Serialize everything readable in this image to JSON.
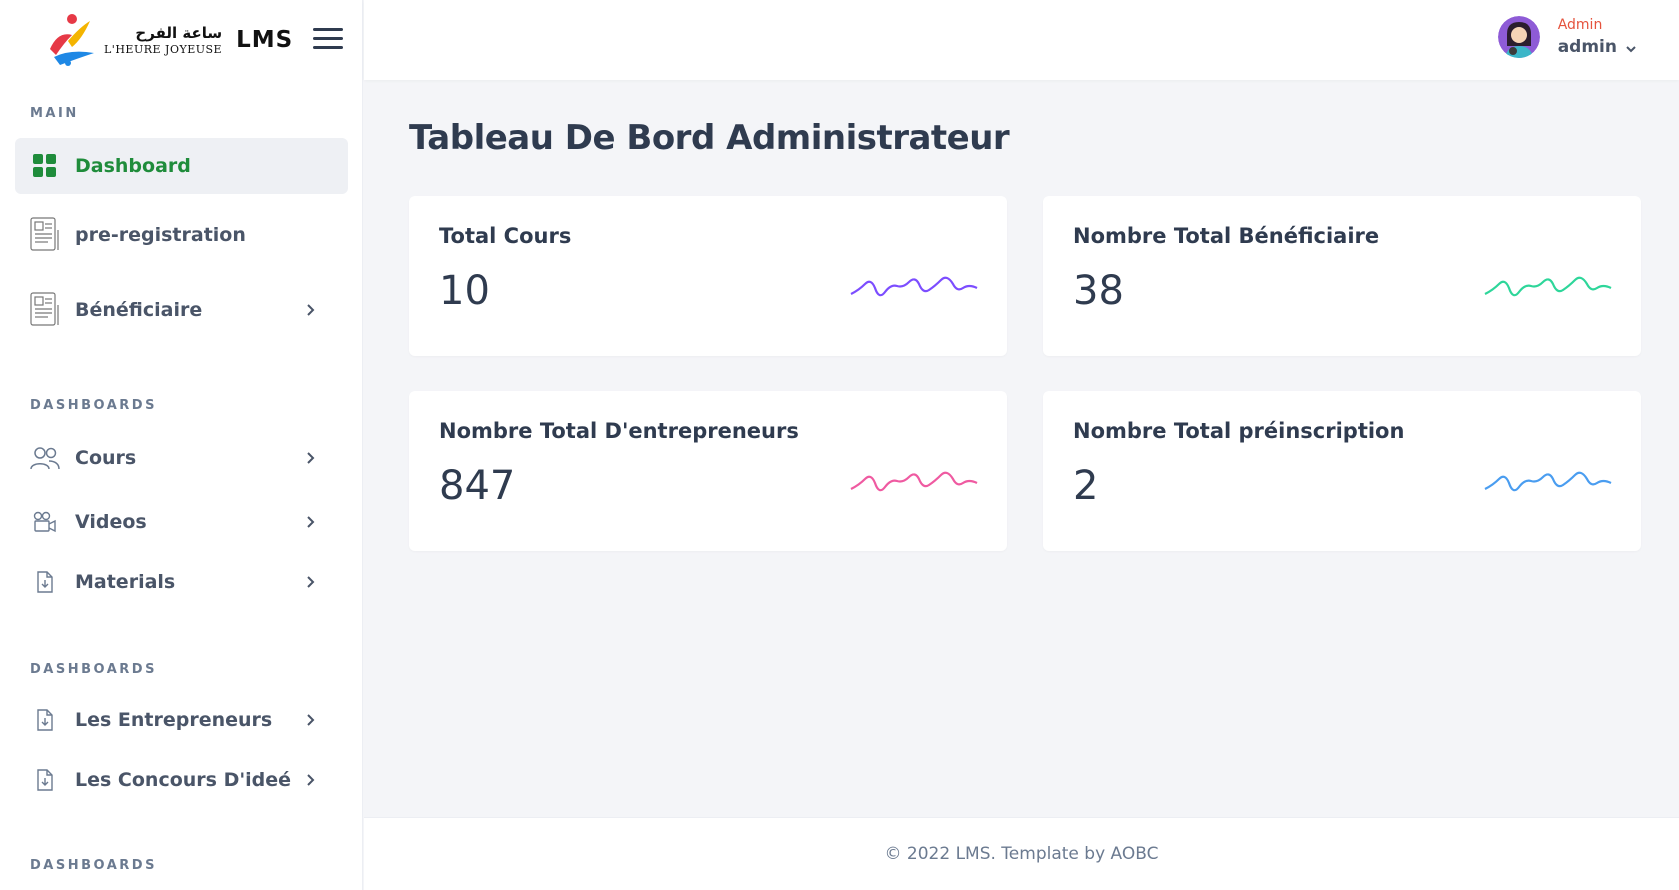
{
  "brand": {
    "arabic": "ساعة الفرح",
    "french": "L'HEURE JOYEUSE",
    "product": "LMS"
  },
  "sidebar": {
    "sections": [
      {
        "title": "MAIN"
      },
      {
        "title": "DASHBOARDS"
      },
      {
        "title": "DASHBOARDS"
      },
      {
        "title": "DASHBOARDS"
      }
    ],
    "items": [
      {
        "label": "Dashboard",
        "icon": "grid-icon",
        "active": true
      },
      {
        "label": "pre-registration",
        "icon": "form-icon"
      },
      {
        "label": "Bénéficiaire",
        "icon": "form-icon"
      },
      {
        "label": "Cours",
        "icon": "users-icon"
      },
      {
        "label": "Videos",
        "icon": "video-camera-icon"
      },
      {
        "label": "Materials",
        "icon": "file-download-icon"
      },
      {
        "label": "Les Entrepreneurs",
        "icon": "file-download-icon"
      },
      {
        "label": "Les Concours D'ideé",
        "icon": "file-download-icon"
      }
    ]
  },
  "header": {
    "user_role": "Admin",
    "user_name": "admin"
  },
  "main": {
    "title": "Tableau De Bord Administrateur",
    "cards": [
      {
        "title": "Total Cours",
        "value": "10",
        "color": "#7c4dff"
      },
      {
        "title": "Nombre Total Bénéficiaire",
        "value": "38",
        "color": "#2ed69a"
      },
      {
        "title": "Nombre Total D'entrepreneurs",
        "value": "847",
        "color": "#ef5aa1"
      },
      {
        "title": "Nombre Total préinscription",
        "value": "2",
        "color": "#4a9df0"
      }
    ]
  },
  "footer": {
    "text": "© 2022 LMS. Template by AOBC"
  },
  "colors": {
    "active_green": "#1f8c3b",
    "role_red": "#e5533d"
  }
}
